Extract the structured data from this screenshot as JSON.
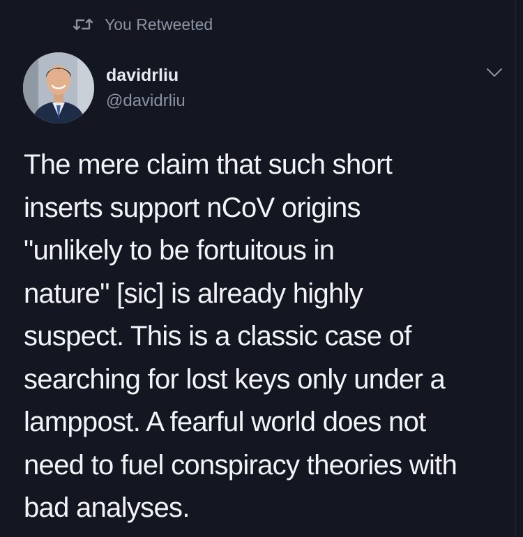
{
  "retweet_banner": {
    "icon": "retweet-icon",
    "label": "You Retweeted"
  },
  "author": {
    "display_name": "davidrliu",
    "handle": "@davidrliu",
    "avatar": "profile-photo"
  },
  "menu": {
    "icon": "chevron-down-icon"
  },
  "tweet": {
    "text": "The mere claim that such short\ninserts support nCoV origins\n\"unlikely to be fortuitous in\nnature\" [sic] is already highly\nsuspect. This is a classic case of\nsearching for lost keys only under a\nlamppost. A fearful world does not\nneed to fuel conspiracy theories with\nbad analyses."
  },
  "colors": {
    "background": "#141722",
    "primary_text": "#f2f4f7",
    "secondary_text": "#8b93a3"
  }
}
